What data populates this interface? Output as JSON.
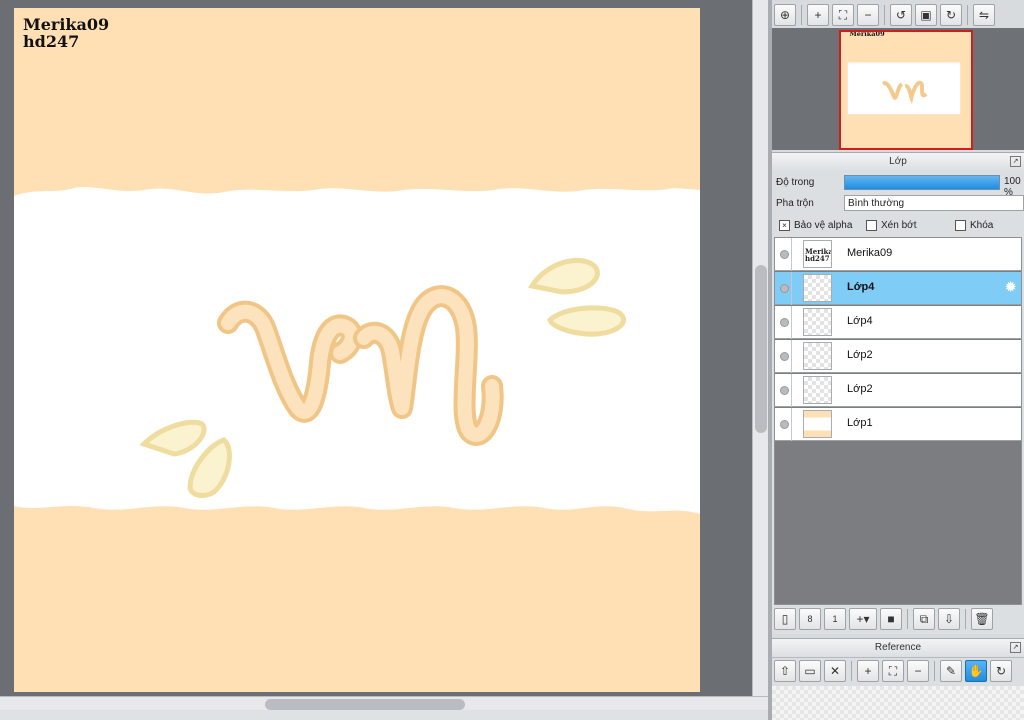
{
  "canvas": {
    "signature_line1": "Merika09",
    "signature_line2": "hd247",
    "colors": {
      "background": "#ffe0b5",
      "band": "#ffffff",
      "letters": "#f9cf97"
    }
  },
  "navigator": {
    "toolbar_icons": [
      "zoom-fit-icon",
      "zoom-in-icon",
      "fit-screen-icon",
      "zoom-out-icon",
      "rotate-left-icon",
      "fit-window-icon",
      "rotate-right-icon",
      "flip-icon"
    ]
  },
  "layer_panel": {
    "title": "Lớp",
    "opacity_label": "Độ trong",
    "opacity_value": "100 %",
    "blend_label": "Pha trộn",
    "blend_value": "Bình thường",
    "protect_alpha_label": "Bảo vệ alpha",
    "clipping_label": "Xén bớt",
    "lock_label": "Khóa",
    "layers": [
      {
        "name": "Merika09",
        "selected": false,
        "thumb": "text"
      },
      {
        "name": "Lớp4",
        "selected": true,
        "thumb": "empty"
      },
      {
        "name": "Lớp4",
        "selected": false,
        "thumb": "empty"
      },
      {
        "name": "Lớp2",
        "selected": false,
        "thumb": "empty"
      },
      {
        "name": "Lớp2",
        "selected": false,
        "thumb": "empty"
      },
      {
        "name": "Lớp1",
        "selected": false,
        "thumb": "band"
      }
    ],
    "tool_icons": [
      "new-layer-icon",
      "new-layer-8bit-icon",
      "new-layer-1bit-icon",
      "add-layer-menu-icon",
      "folder-icon",
      "duplicate-layer-icon",
      "merge-down-icon",
      "delete-layer-icon"
    ]
  },
  "reference_panel": {
    "title": "Reference",
    "tool_icons": [
      "import-icon",
      "open-folder-icon",
      "close-icon",
      "zoom-in-icon",
      "fit-icon",
      "zoom-out-icon",
      "eyedropper-icon",
      "hand-icon",
      "rotate-icon"
    ]
  }
}
